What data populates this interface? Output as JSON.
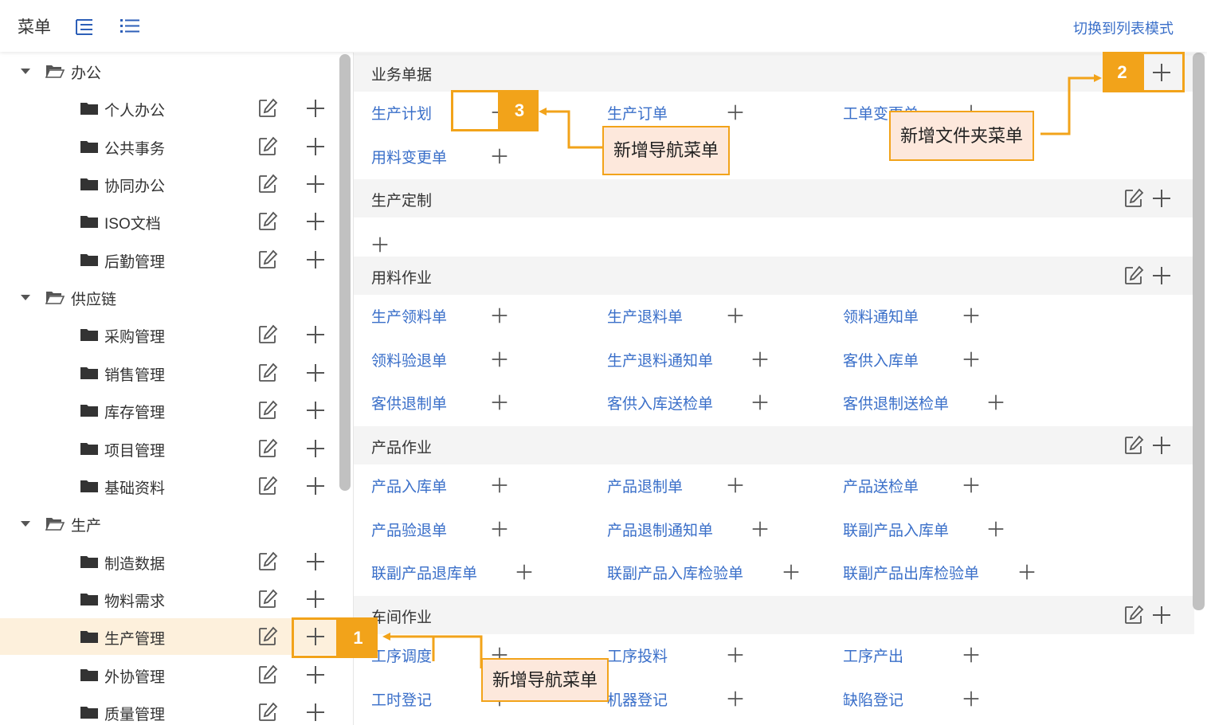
{
  "header": {
    "title": "菜单",
    "switch_link": "切换到列表模式",
    "icons": [
      "expand-tree-icon",
      "list-icon"
    ]
  },
  "sidebar": {
    "groups": [
      {
        "label": "办公",
        "items": [
          {
            "label": "个人办公"
          },
          {
            "label": "公共事务"
          },
          {
            "label": "协同办公"
          },
          {
            "label": "ISO文档"
          },
          {
            "label": "后勤管理"
          }
        ]
      },
      {
        "label": "供应链",
        "items": [
          {
            "label": "采购管理"
          },
          {
            "label": "销售管理"
          },
          {
            "label": "库存管理"
          },
          {
            "label": "项目管理"
          },
          {
            "label": "基础资料"
          }
        ]
      },
      {
        "label": "生产",
        "items": [
          {
            "label": "制造数据"
          },
          {
            "label": "物料需求"
          },
          {
            "label": "生产管理",
            "selected": true
          },
          {
            "label": "外协管理"
          },
          {
            "label": "质量管理"
          }
        ]
      }
    ]
  },
  "main": {
    "sections": [
      {
        "title": "业务单据",
        "items": [
          "生产计划",
          "生产订单",
          "工单变更单",
          "用料变更单"
        ]
      },
      {
        "title": "生产定制",
        "items": []
      },
      {
        "title": "用料作业",
        "items": [
          "生产领料单",
          "生产退料单",
          "领料通知单",
          "领料验退单",
          "生产退料通知单",
          "客供入库单",
          "客供退制单",
          "客供入库送检单",
          "客供退制送检单"
        ]
      },
      {
        "title": "产品作业",
        "items": [
          "产品入库单",
          "产品退制单",
          "产品送检单",
          "产品验退单",
          "产品退制通知单",
          "联副产品入库单",
          "联副产品退库单",
          "联副产品入库检验单",
          "联副产品出库检验单"
        ]
      },
      {
        "title": "车间作业",
        "items": [
          "工序调度",
          "工序投料",
          "工序产出",
          "工时登记",
          "机器登记",
          "缺陷登记"
        ]
      }
    ]
  },
  "annotations": {
    "marker_1": "1",
    "marker_2": "2",
    "marker_3": "3",
    "callout_1": "新增导航菜单",
    "callout_2": "新增文件夹菜单",
    "callout_3": "新增导航菜单",
    "color": "#f2a31a"
  },
  "colors": {
    "link": "#3a6fc9",
    "selected_row": "#fdf0dc",
    "section_header": "#f4f4f4"
  }
}
